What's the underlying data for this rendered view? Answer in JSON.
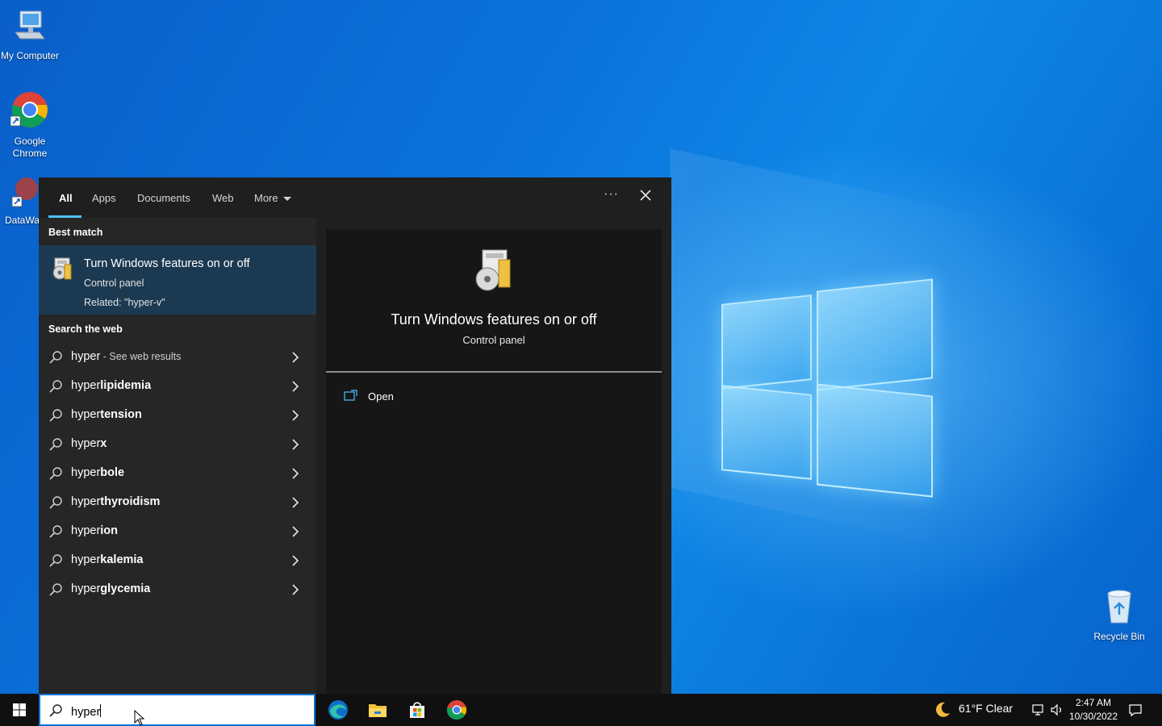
{
  "desktop": {
    "icons": [
      {
        "label": "My Computer",
        "icon": "computer-icon"
      },
      {
        "label": "Google Chrome",
        "icon": "chrome-icon"
      },
      {
        "label": "DataWa",
        "icon": "datawarehouse-icon"
      },
      {
        "label": "Recycle Bin",
        "icon": "recycle-bin-icon"
      }
    ]
  },
  "search_panel": {
    "tabs": [
      {
        "label": "All",
        "active": true
      },
      {
        "label": "Apps"
      },
      {
        "label": "Documents"
      },
      {
        "label": "Web"
      },
      {
        "label": "More"
      }
    ],
    "more_options": "···",
    "best_match_heading": "Best match",
    "best_match": {
      "title": "Turn Windows features on or off",
      "subtitle": "Control panel",
      "related": "Related: \"hyper-v\"",
      "icon": "windows-features-icon"
    },
    "web_heading": "Search the web",
    "web_results": [
      {
        "prefix": "hyper",
        "suffix": "",
        "extra": " - See web results"
      },
      {
        "prefix": "hyper",
        "suffix": "lipidemia",
        "extra": ""
      },
      {
        "prefix": "hyper",
        "suffix": "tension",
        "extra": ""
      },
      {
        "prefix": "hyper",
        "suffix": "x",
        "extra": ""
      },
      {
        "prefix": "hyper",
        "suffix": "bole",
        "extra": ""
      },
      {
        "prefix": "hyper",
        "suffix": "thyroidism",
        "extra": ""
      },
      {
        "prefix": "hyper",
        "suffix": "ion",
        "extra": ""
      },
      {
        "prefix": "hyper",
        "suffix": "kalemia",
        "extra": ""
      },
      {
        "prefix": "hyper",
        "suffix": "glycemia",
        "extra": ""
      }
    ],
    "detail": {
      "title": "Turn Windows features on or off",
      "subtitle": "Control panel",
      "action": "Open"
    }
  },
  "taskbar": {
    "search_value": "hyper",
    "pinned": [
      "edge-icon",
      "file-explorer-icon",
      "store-icon",
      "chrome-icon"
    ],
    "weather": "61°F  Clear",
    "time": "2:47 AM",
    "date": "10/30/2022"
  }
}
